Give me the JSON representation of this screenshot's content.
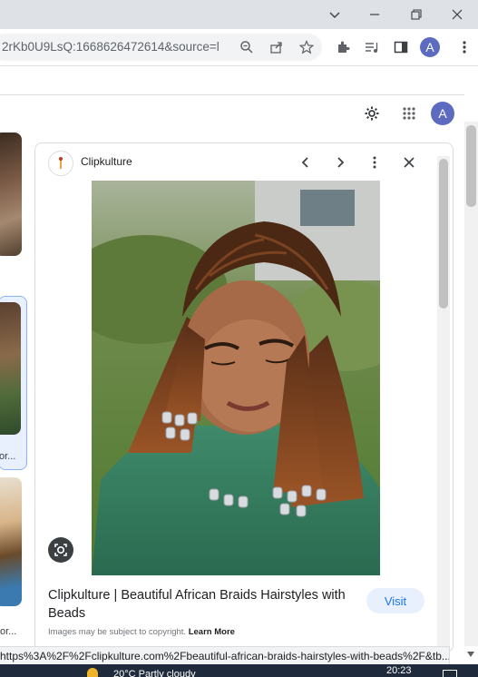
{
  "browser": {
    "url": "2rKb0U9LsQ:1668626472614&source=l...",
    "avatar_letter": "A",
    "status_url": "https%3A%2F%2Fclipkulture.com%2Fbeautiful-african-braids-hairstyles-with-beads%2F&tb..."
  },
  "google": {
    "avatar_letter": "A"
  },
  "left_strip": {
    "captions": [
      "or...",
      "or..."
    ]
  },
  "panel": {
    "source_name": "Clipkulture",
    "title": "Clipkulture | Beautiful African Braids Hairstyles with Beads",
    "visit_label": "Visit",
    "copyright_text": "Images may be subject to copyright.",
    "learn_more": "Learn More"
  },
  "taskbar": {
    "weather": "20°C  Partly cloudy",
    "time": "20:23"
  },
  "colors": {
    "accent": "#1a73e8",
    "avatar": "#5c6bc0"
  }
}
